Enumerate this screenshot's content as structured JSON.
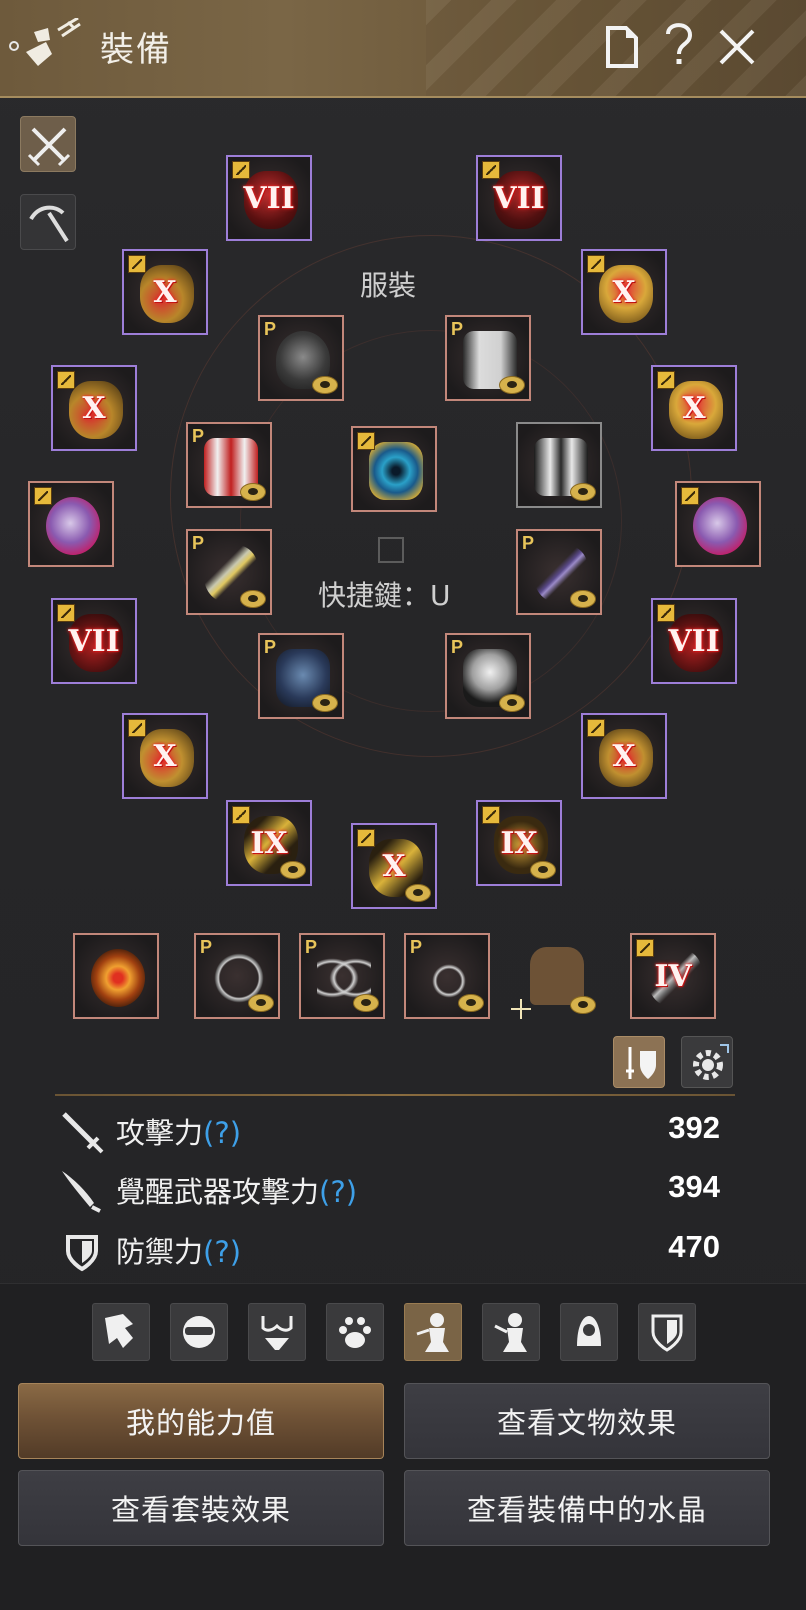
{
  "window": {
    "title": "裝備",
    "header_icons": [
      "equipment-icon",
      "document-icon",
      "help-icon",
      "close-icon"
    ]
  },
  "side_tools": [
    "crossed-swords-icon",
    "pickaxe-icon"
  ],
  "costume_label": "服裝",
  "hotkey_label": "快捷鍵：U",
  "slots": {
    "helmet_left": {
      "enhance": "VII",
      "rarity": "purple"
    },
    "helmet_right": {
      "enhance": "VII",
      "rarity": "purple"
    },
    "ring_left_top": {
      "enhance": "X",
      "rarity": "purple"
    },
    "ring_right_top": {
      "enhance": "X",
      "rarity": "purple"
    },
    "earring_left": {
      "enhance": "X",
      "rarity": "purple"
    },
    "earring_right": {
      "enhance": "X",
      "rarity": "purple"
    },
    "belt_left": {
      "enhance": "",
      "rarity": "purple"
    },
    "belt_right": {
      "enhance": "",
      "rarity": "purple"
    },
    "glove_left": {
      "enhance": "VII",
      "rarity": "purple"
    },
    "glove_right": {
      "enhance": "VII",
      "rarity": "purple"
    },
    "necklace_left": {
      "enhance": "X",
      "rarity": "purple"
    },
    "necklace_right": {
      "enhance": "X",
      "rarity": "purple"
    },
    "main_weapon": {
      "enhance": "IX",
      "rarity": "purple"
    },
    "sub_weapon": {
      "enhance": "IX",
      "rarity": "purple"
    },
    "awakening_weapon": {
      "enhance": "X",
      "rarity": "purple"
    },
    "life_tool": {
      "enhance": "IV",
      "rarity": "pink"
    }
  },
  "costume_slots": {
    "hat": {
      "tag": "P"
    },
    "outfit": {
      "tag": "P"
    },
    "shoes": {
      "tag": "P"
    },
    "crystal": {
      "tag": ""
    },
    "jacket": {
      "tag": ""
    },
    "weapon_costume": {
      "tag": "P"
    },
    "sword_costume": {
      "tag": "P"
    },
    "gloves_costume": {
      "tag": "P"
    },
    "underwear": {
      "tag": "P"
    }
  },
  "accessory_row": {
    "emblem": {
      "tag": ""
    },
    "necklace": {
      "tag": "P"
    },
    "glasses": {
      "tag": "P"
    },
    "earring": {
      "tag": "P"
    },
    "cloak": {
      "tag": ""
    }
  },
  "stats": [
    {
      "label": "攻擊力",
      "q": "(?)",
      "value": "392",
      "icon": "sword-icon"
    },
    {
      "label": "覺醒武器攻擊力",
      "q": "(?)",
      "value": "394",
      "icon": "awakening-blade-icon"
    },
    {
      "label": "防禦力",
      "q": "(?)",
      "value": "470",
      "icon": "shield-icon"
    }
  ],
  "filter_icons": [
    "armor-icon",
    "mask-icon",
    "underwear-icon",
    "paw-icon",
    "character-icon",
    "character-alt-icon",
    "hood-icon",
    "shield-icon"
  ],
  "buttons": {
    "my_stats": "我的能力值",
    "artifacts": "查看文物效果",
    "set_effects": "查看套裝效果",
    "crystals": "查看裝備中的水晶"
  },
  "colors": {
    "header": "#7a6646",
    "rarity_purple": "#9d7ed8",
    "rarity_pink": "#c2877a",
    "primary_button": "#6f5236",
    "help_blue": "#3ea0e8"
  }
}
